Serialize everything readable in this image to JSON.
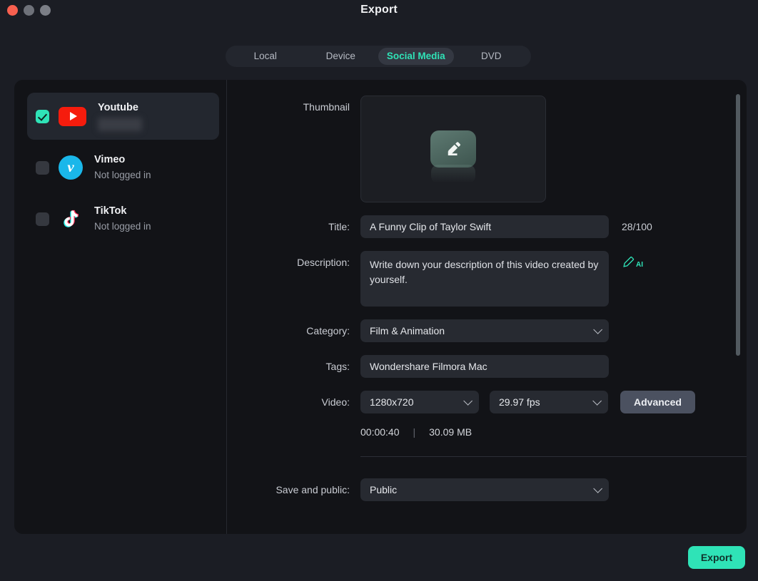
{
  "window": {
    "title": "Export",
    "traffic_lights": [
      "close-button",
      "minimize-button",
      "maximize-button"
    ]
  },
  "tabs": [
    {
      "label": "Local",
      "active": false
    },
    {
      "label": "Device",
      "active": false
    },
    {
      "label": "Social Media",
      "active": true
    },
    {
      "label": "DVD",
      "active": false
    }
  ],
  "sidebar": {
    "accounts": [
      {
        "name": "Youtube",
        "status": "",
        "checked": true,
        "redacted_account": true
      },
      {
        "name": "Vimeo",
        "status": "Not logged in",
        "checked": false,
        "redacted_account": false
      },
      {
        "name": "TikTok",
        "status": "Not logged in",
        "checked": false,
        "redacted_account": false
      }
    ]
  },
  "form": {
    "thumbnail_label": "Thumbnail",
    "title_label": "Title:",
    "title_value": "A Funny Clip of Taylor Swift",
    "title_counter": "28/100",
    "description_label": "Description:",
    "description_value": "Write down your description of this video created by yourself.",
    "ai_badge": "AI",
    "category_label": "Category:",
    "category_value": "Film & Animation",
    "tags_label": "Tags:",
    "tags_value": "Wondershare Filmora Mac",
    "video_label": "Video:",
    "resolution_value": "1280x720",
    "framerate_value": "29.97 fps",
    "advanced_label": "Advanced",
    "duration": "00:00:40",
    "separator": "|",
    "filesize": "30.09 MB",
    "privacy_label": "Save and public:",
    "privacy_value": "Public"
  },
  "footer": {
    "export_label": "Export"
  },
  "colors": {
    "accent": "#2fe3b7",
    "youtube_red": "#f61c0d",
    "vimeo_blue": "#1ab7ea",
    "close_red": "#f8604f"
  }
}
